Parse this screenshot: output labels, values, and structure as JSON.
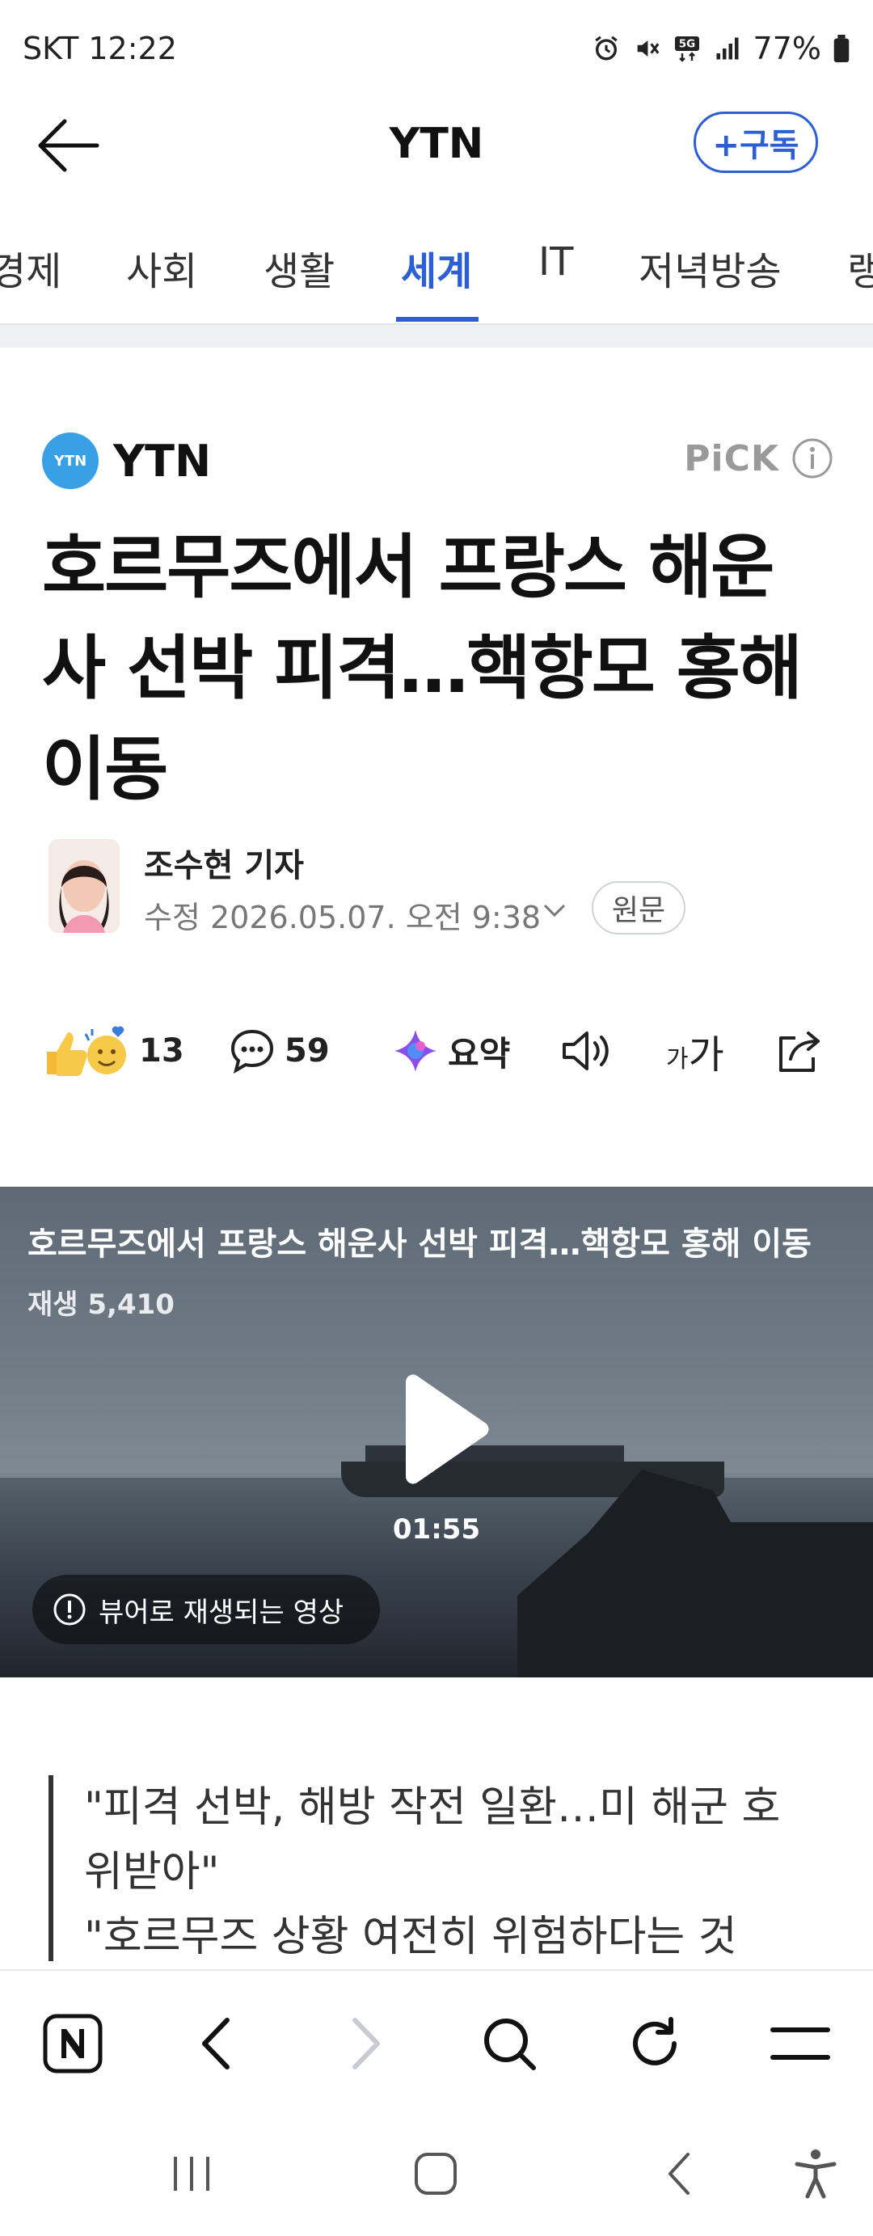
{
  "status": {
    "carrier_time": "SKT 12:22",
    "battery": "77%"
  },
  "header": {
    "title": "YTN",
    "subscribe_label": "+구독"
  },
  "tabs": [
    "경제",
    "사회",
    "생활",
    "세계",
    "IT",
    "저녁방송",
    "랭"
  ],
  "active_tab": "세계",
  "press": {
    "logo_text": "YTN",
    "name": "YTN",
    "pick_label": "PiCK"
  },
  "article": {
    "headline_lines": [
      "호르무즈에서 프랑스 해운",
      "사 선박 피격…핵항모 홍해",
      "이동"
    ],
    "author": "조수현 기자",
    "date": "수정 2026.05.07. 오전 9:38",
    "origin_label": "원문"
  },
  "actions": {
    "reaction_count": "13",
    "comment_count": "59",
    "summary_label": "요약",
    "font_label_small": "가",
    "font_label_large": "가"
  },
  "video": {
    "title": "호르무즈에서 프랑스 해운사 선박 피격…핵항모 홍해 이동",
    "views": "재생 5,410",
    "duration": "01:55",
    "viewer_notice": "뷰어로 재생되는 영상"
  },
  "quote": {
    "lines": [
      "\"피격 선박, 해방 작전 일환…미 해군 호",
      "위받아\"",
      "\"호르무즈 상황 여전히 위험하다는 것"
    ]
  },
  "colors": {
    "accent": "#2c5fd6",
    "press_logo": "#3aa0e6"
  },
  "icons": [
    "back-arrow-icon",
    "alarm-icon",
    "mute-icon",
    "5g-icon",
    "signal-icon",
    "battery-icon",
    "info-icon",
    "chevron-down-icon",
    "reaction-emoji-icon",
    "comment-icon",
    "summary-sparkle-icon",
    "speaker-icon",
    "share-icon",
    "play-icon",
    "alert-circle-icon",
    "naver-icon",
    "back-icon",
    "forward-icon",
    "search-icon",
    "refresh-icon",
    "menu-icon",
    "recent-apps-icon",
    "home-icon",
    "system-back-icon",
    "accessibility-icon"
  ]
}
